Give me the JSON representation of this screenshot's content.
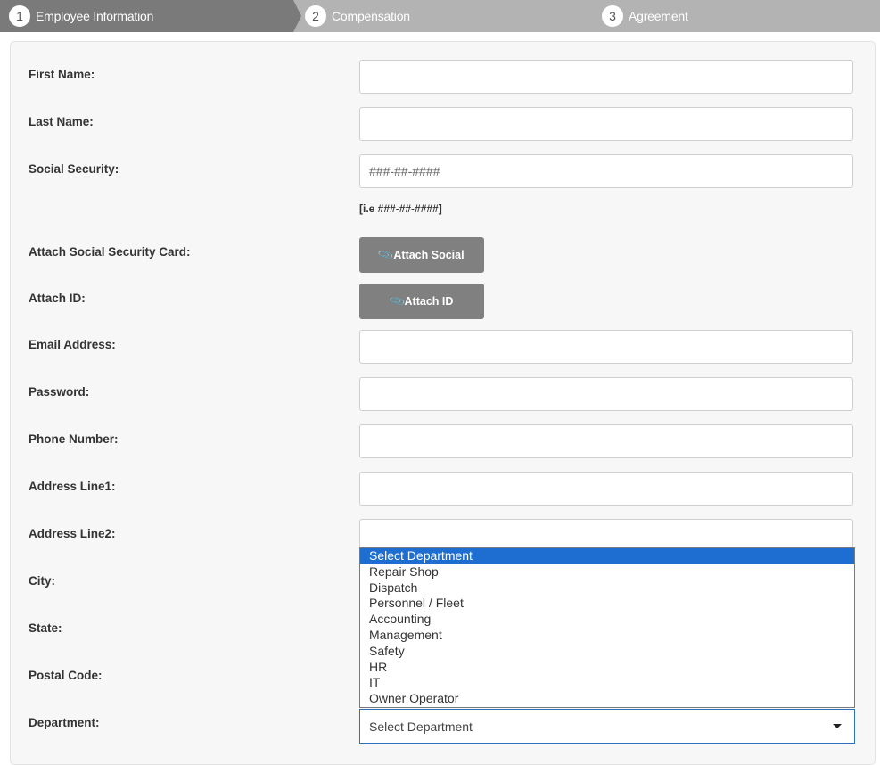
{
  "steps": [
    {
      "num": "1",
      "label": "Employee Information",
      "active": true
    },
    {
      "num": "2",
      "label": "Compensation",
      "active": false
    },
    {
      "num": "3",
      "label": "Agreement",
      "active": false
    }
  ],
  "form": {
    "first_name_label": "First Name:",
    "last_name_label": "Last Name:",
    "ssn_label": "Social Security:",
    "ssn_placeholder": "###-##-####",
    "ssn_hint": "[i.e ###-##-####]",
    "attach_social_label": "Attach Social Security Card:",
    "attach_social_button": "Attach Social",
    "attach_id_label": "Attach ID:",
    "attach_id_button": "Attach ID",
    "email_label": "Email Address:",
    "password_label": "Password:",
    "phone_label": "Phone Number:",
    "address1_label": "Address Line1:",
    "address2_label": "Address Line2:",
    "city_label": "City:",
    "state_label": "State:",
    "postal_label": "Postal Code:",
    "department_label": "Department:",
    "department_value": "Select Department"
  },
  "department_options": [
    "Select Department",
    "Repair Shop",
    "Dispatch",
    "Personnel / Fleet",
    "Accounting",
    "Management",
    "Safety",
    "HR",
    "IT",
    "Owner Operator"
  ],
  "icons": {
    "attach": "paperclip-icon",
    "select": "caret-down-icon"
  },
  "colors": {
    "active_step_bg": "#7a7a7a",
    "steps_bg": "#b3b3b3",
    "button_bg": "#808080",
    "option_highlight": "#1e6ed1",
    "select_focus_border": "#2d73b9"
  }
}
